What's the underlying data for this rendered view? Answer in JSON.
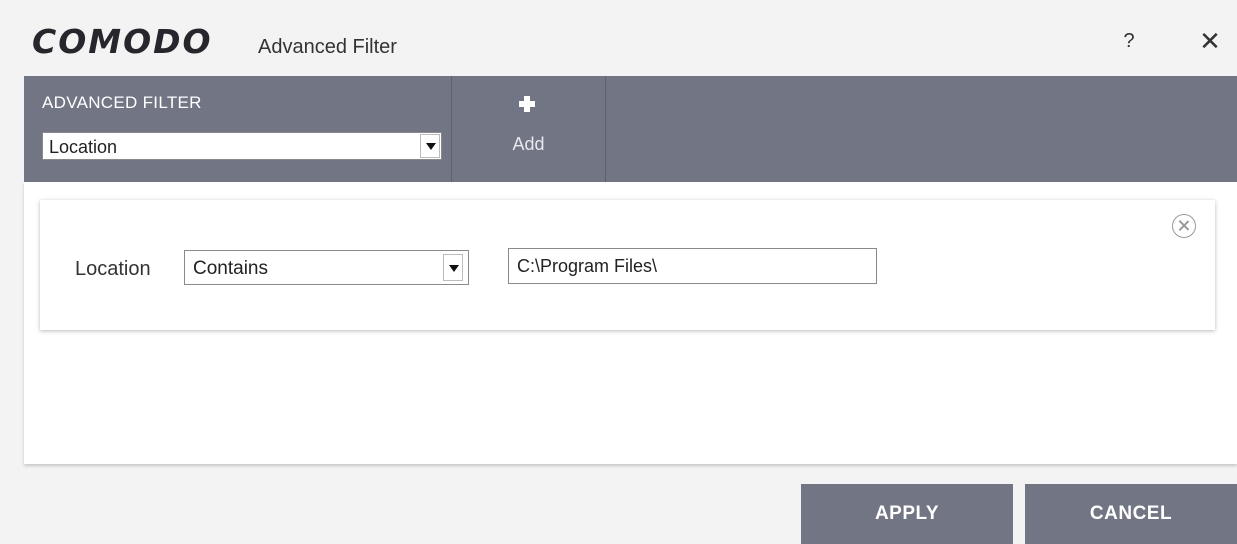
{
  "window": {
    "logo": "COMODO",
    "title": "Advanced Filter",
    "help_label": "?",
    "close_label": "✕"
  },
  "toolbar": {
    "section_label": "ADVANCED FILTER",
    "filter_selected": "Location",
    "add_label": "Add"
  },
  "rule": {
    "label": "Location",
    "condition_selected": "Contains",
    "value": "C:\\Program Files\\"
  },
  "footer": {
    "apply_label": "APPLY",
    "cancel_label": "CANCEL"
  },
  "colors": {
    "toolbar_bg": "#727583",
    "button_bg": "#727583",
    "window_bg": "#f3f3f3",
    "panel_bg": "#ffffff"
  }
}
